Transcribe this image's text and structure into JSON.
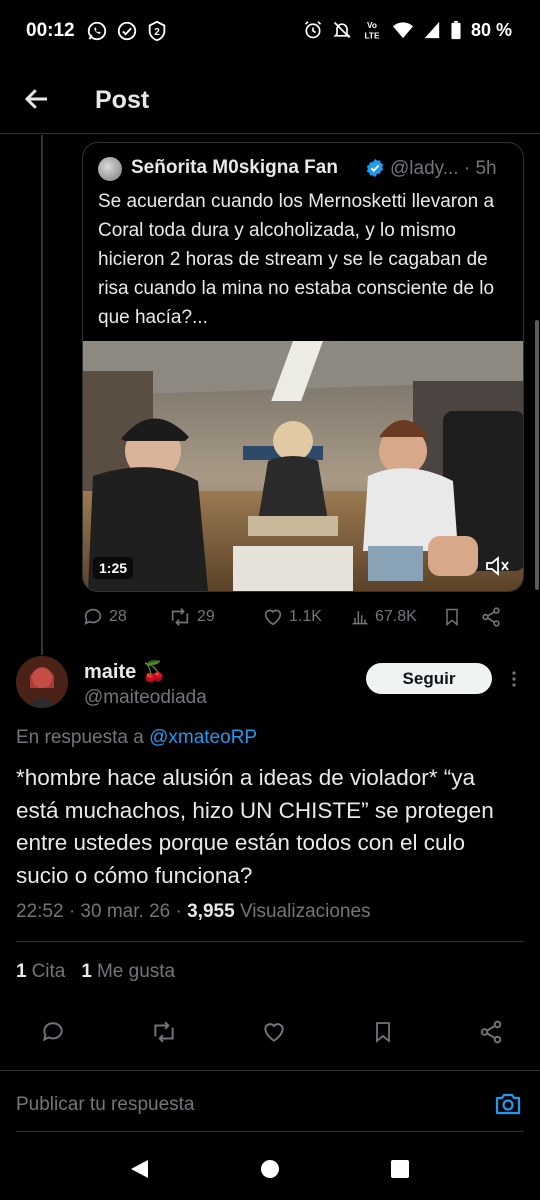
{
  "status_bar": {
    "time": "00:12",
    "battery": "80 %",
    "left_icons": [
      "whatsapp-icon",
      "check-circle-icon",
      "notification-2-icon"
    ],
    "right_icons": [
      "alarm-icon",
      "mute-icon",
      "volte-icon",
      "wifi-icon",
      "signal-icon",
      "battery-icon"
    ]
  },
  "header": {
    "title": "Post"
  },
  "quoted_post": {
    "author_name": "Señorita M0skigna Fan",
    "handle": "@lady...",
    "time": "5h",
    "text": "Se acuerdan cuando los Mernosketti llevaron a Coral toda dura y alcoholizada, y lo mismo hicieron 2 horas de stream y se le cagaban de risa cuando la mina no estaba consciente de lo que hacía?...",
    "video_duration": "1:25",
    "replies": "28",
    "reposts": "29",
    "likes": "1.1K",
    "views": "67.8K"
  },
  "reply_post": {
    "author_name": "maite",
    "author_emoji": "🍒",
    "handle": "@maiteodiada",
    "follow_label": "Seguir",
    "replying_prefix": "En respuesta a",
    "replying_to": "@xmateoRP",
    "text": "*hombre hace alusión a ideas de violador* “ya está muchachos, hizo UN CHISTE” se protegen entre ustedes porque están todos con el culo sucio o cómo funciona?",
    "timestamp": "22:52 · 30 mar. 26 ·",
    "views_count": "3,955",
    "views_label": "Visualizaciones",
    "quotes_count": "1",
    "quotes_label": "Cita",
    "likes_count": "1",
    "likes_label": "Me gusta"
  },
  "composer": {
    "placeholder": "Publicar tu respuesta"
  },
  "colors": {
    "accent": "#1d9bf0",
    "muted": "#71767b",
    "text": "#e7e9ea",
    "background": "#000000"
  }
}
